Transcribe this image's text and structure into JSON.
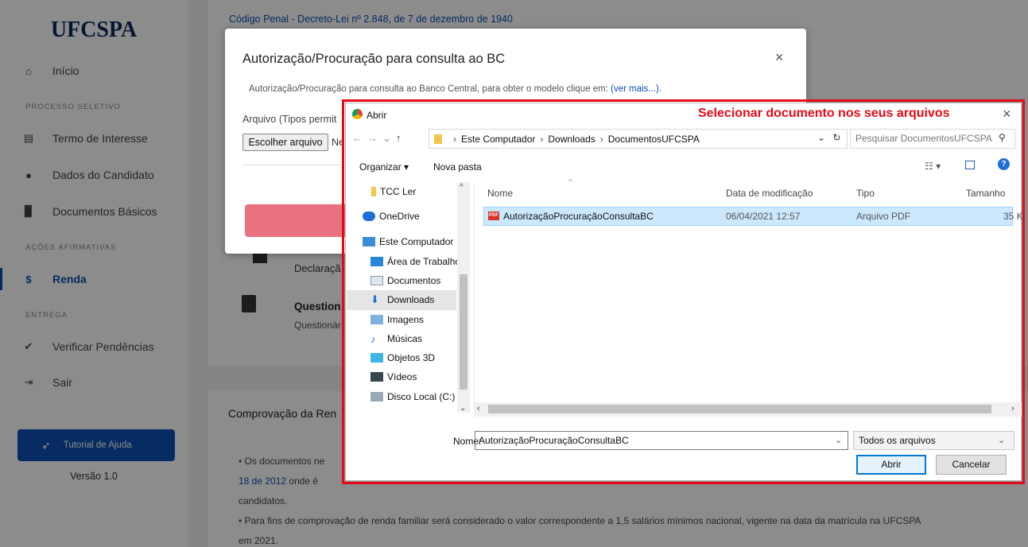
{
  "sidebar": {
    "logo": "UFCSPA",
    "inicio": "Início",
    "sec_processo": "PROCESSO SELETIVO",
    "termo": "Termo de Interesse",
    "dados": "Dados do Candidato",
    "documentos": "Documentos Básicos",
    "sec_acoes": "AÇÕES AFIRMATIVAS",
    "renda": "Renda",
    "sec_entrega": "ENTREGA",
    "verificar": "Verificar Pendências",
    "sair": "Sair",
    "tutorial": "Tutorial de Ajuda",
    "versao": "Versão 1.0"
  },
  "main": {
    "codigo": "Código Penal - Decreto-Lei nº 2.848, de 7 de dezembro de 1940",
    "declaracao": "Declaraçã",
    "questionario": "Question",
    "questionario_sub": "Questionár",
    "comprovacao": "Comprovação da Ren",
    "para1a": "• Os documentos ne",
    "para1b_link": "18 de 2012",
    "para1b": " onde é",
    "para1c": "candidatos.",
    "para2": "• Para fins de comprovação de renda familiar será considerado o valor correspondente a 1,5 salários mínimos nacional, vigente na data da matrícula na UFCSPA",
    "para3": "em 2021."
  },
  "modal": {
    "title": "Autorização/Procuração para consulta ao BC",
    "close": "×",
    "desc": "Autorização/Procuração para consulta ao Banco Central, para obter o modelo clique em: ",
    "desc_link": "(ver mais...)",
    "desc_end": ".",
    "file_label": "Arquivo (Tipos permit",
    "choose_btn": "Escolher arquivo",
    "no_file": "Ne"
  },
  "dialog": {
    "title": "Abrir",
    "annotation": "Selecionar documento nos seus arquivos",
    "close": "×",
    "path": [
      "Este Computador",
      "Downloads",
      "DocumentosUFCSPA"
    ],
    "search_placeholder": "Pesquisar DocumentosUFCSPA",
    "organizar": "Organizar ▾",
    "nova_pasta": "Nova pasta",
    "nav": [
      "TCC Ler",
      "OneDrive",
      "Este Computador",
      "Área de Trabalho",
      "Documentos",
      "Downloads",
      "Imagens",
      "Músicas",
      "Objetos 3D",
      "Vídeos",
      "Disco Local (C:)"
    ],
    "columns": [
      "Nome",
      "Data de modificação",
      "Tipo",
      "Tamanho"
    ],
    "file": {
      "name": "AutorizaçãoProcuraçãoConsultaBC",
      "date": "06/04/2021 12:57",
      "type": "Arquivo PDF",
      "size": "35 K"
    },
    "nome_label": "Nome:",
    "nome_value": "AutorizaçãoProcuraçãoConsultaBC",
    "filetype": "Todos os arquivos",
    "open": "Abrir",
    "cancel": "Cancelar"
  },
  "colors": {
    "accent": "#0b4fb3",
    "annotation": "#e30b17",
    "selection": "#cce8ff"
  }
}
